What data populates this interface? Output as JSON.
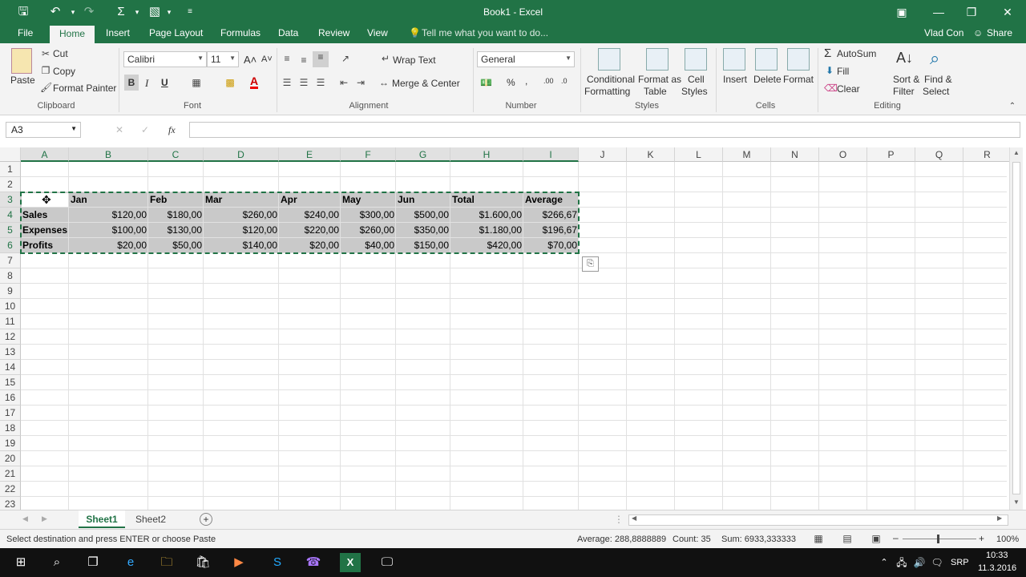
{
  "window": {
    "title": "Book1 - Excel",
    "user": "Vlad Con",
    "share": "Share"
  },
  "tabs": [
    {
      "label": "File"
    },
    {
      "label": "Home"
    },
    {
      "label": "Insert"
    },
    {
      "label": "Page Layout"
    },
    {
      "label": "Formulas"
    },
    {
      "label": "Data"
    },
    {
      "label": "Review"
    },
    {
      "label": "View"
    }
  ],
  "tell_me": "Tell me what you want to do...",
  "ribbon": {
    "clipboard": {
      "paste": "Paste",
      "cut": "Cut",
      "copy": "Copy",
      "format_painter": "Format Painter",
      "label": "Clipboard"
    },
    "font": {
      "name": "Calibri",
      "size": "11",
      "bold": "B",
      "italic": "I",
      "underline": "U",
      "label": "Font"
    },
    "alignment": {
      "wrap": "Wrap Text",
      "merge": "Merge & Center",
      "label": "Alignment"
    },
    "number": {
      "format": "General",
      "label": "Number"
    },
    "styles": {
      "cond1": "Conditional",
      "cond2": "Formatting",
      "fat1": "Format as",
      "fat2": "Table",
      "cs1": "Cell",
      "cs2": "Styles",
      "label": "Styles"
    },
    "cells": {
      "insert": "Insert",
      "delete": "Delete",
      "format": "Format",
      "label": "Cells"
    },
    "editing": {
      "autosum": "AutoSum",
      "fill": "Fill",
      "clear": "Clear",
      "sort1": "Sort &",
      "sort2": "Filter",
      "find1": "Find &",
      "find2": "Select",
      "label": "Editing"
    }
  },
  "formula_bar": {
    "name_box": "A3",
    "fx": "fx",
    "value": ""
  },
  "columns": [
    "A",
    "B",
    "C",
    "D",
    "E",
    "F",
    "G",
    "H",
    "I",
    "J",
    "K",
    "L",
    "M",
    "N",
    "O",
    "P",
    "Q",
    "R"
  ],
  "rows": [
    "1",
    "2",
    "3",
    "4",
    "5",
    "6",
    "7",
    "8",
    "9",
    "10",
    "11",
    "12",
    "13",
    "14",
    "15",
    "16",
    "17",
    "18",
    "19",
    "20",
    "21",
    "22",
    "23"
  ],
  "sheet": {
    "header": [
      "",
      "Jan",
      "Feb",
      "Mar",
      "Apr",
      "May",
      "Jun",
      "Total",
      "Average"
    ],
    "data": [
      [
        "Sales",
        "$120,00",
        "$180,00",
        "$260,00",
        "$240,00",
        "$300,00",
        "$500,00",
        "$1.600,00",
        "$266,67"
      ],
      [
        "Expenses",
        "$100,00",
        "$130,00",
        "$120,00",
        "$220,00",
        "$260,00",
        "$350,00",
        "$1.180,00",
        "$196,67"
      ],
      [
        "Profits",
        "$20,00",
        "$50,00",
        "$140,00",
        "$20,00",
        "$40,00",
        "$150,00",
        "$420,00",
        "$70,00"
      ]
    ]
  },
  "sheet_tabs": [
    "Sheet1",
    "Sheet2"
  ],
  "status": {
    "message": "Select destination and press ENTER or choose Paste",
    "average": "Average: 288,8888889",
    "count": "Count: 35",
    "sum": "Sum: 6933,333333",
    "zoom": "100%"
  },
  "taskbar": {
    "lang": "SRP",
    "time": "10:33",
    "date": "11.3.2016"
  },
  "colors": {
    "accent": "#217346",
    "selection": "#c9c9c9"
  }
}
